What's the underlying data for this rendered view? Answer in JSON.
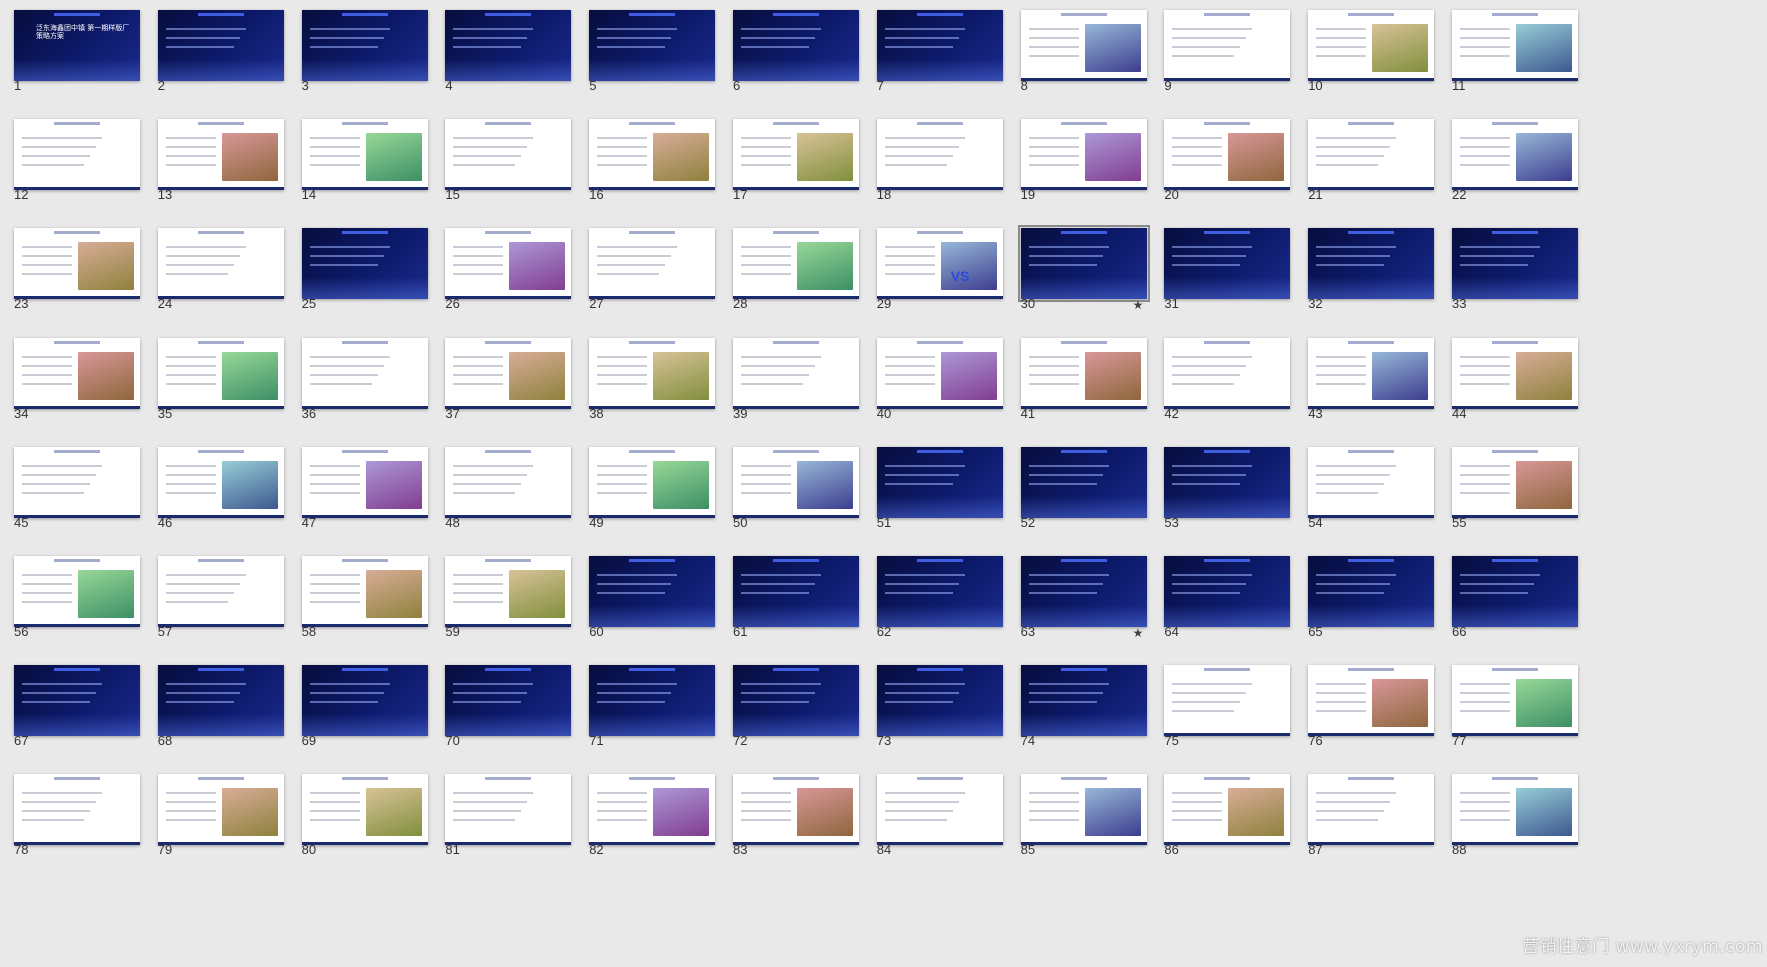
{
  "slides": [
    {
      "number": "1",
      "bg": "dark",
      "title": "泛东海鑫团中镇 第一期样版厂 策略方案"
    },
    {
      "number": "2",
      "bg": "dark"
    },
    {
      "number": "3",
      "bg": "dark"
    },
    {
      "number": "4",
      "bg": "dark"
    },
    {
      "number": "5",
      "bg": "dark"
    },
    {
      "number": "6",
      "bg": "dark"
    },
    {
      "number": "7",
      "bg": "dark"
    },
    {
      "number": "8",
      "bg": "light"
    },
    {
      "number": "9",
      "bg": "light"
    },
    {
      "number": "10",
      "bg": "light"
    },
    {
      "number": "11",
      "bg": "light"
    },
    {
      "number": "12",
      "bg": "light"
    },
    {
      "number": "13",
      "bg": "light"
    },
    {
      "number": "14",
      "bg": "light"
    },
    {
      "number": "15",
      "bg": "light"
    },
    {
      "number": "16",
      "bg": "light"
    },
    {
      "number": "17",
      "bg": "light"
    },
    {
      "number": "18",
      "bg": "light"
    },
    {
      "number": "19",
      "bg": "light"
    },
    {
      "number": "20",
      "bg": "light"
    },
    {
      "number": "21",
      "bg": "light"
    },
    {
      "number": "22",
      "bg": "light"
    },
    {
      "number": "23",
      "bg": "light"
    },
    {
      "number": "24",
      "bg": "light"
    },
    {
      "number": "25",
      "bg": "dark"
    },
    {
      "number": "26",
      "bg": "light"
    },
    {
      "number": "27",
      "bg": "light"
    },
    {
      "number": "28",
      "bg": "light"
    },
    {
      "number": "29",
      "bg": "light",
      "vs": "VS"
    },
    {
      "number": "30",
      "bg": "dark",
      "selected": true,
      "starred": true
    },
    {
      "number": "31",
      "bg": "dark"
    },
    {
      "number": "32",
      "bg": "dark"
    },
    {
      "number": "33",
      "bg": "dark"
    },
    {
      "number": "34",
      "bg": "light"
    },
    {
      "number": "35",
      "bg": "light"
    },
    {
      "number": "36",
      "bg": "light"
    },
    {
      "number": "37",
      "bg": "light"
    },
    {
      "number": "38",
      "bg": "light"
    },
    {
      "number": "39",
      "bg": "light"
    },
    {
      "number": "40",
      "bg": "light"
    },
    {
      "number": "41",
      "bg": "light"
    },
    {
      "number": "42",
      "bg": "light"
    },
    {
      "number": "43",
      "bg": "light"
    },
    {
      "number": "44",
      "bg": "light"
    },
    {
      "number": "45",
      "bg": "light"
    },
    {
      "number": "46",
      "bg": "light"
    },
    {
      "number": "47",
      "bg": "light"
    },
    {
      "number": "48",
      "bg": "light"
    },
    {
      "number": "49",
      "bg": "light"
    },
    {
      "number": "50",
      "bg": "light"
    },
    {
      "number": "51",
      "bg": "dark"
    },
    {
      "number": "52",
      "bg": "dark"
    },
    {
      "number": "53",
      "bg": "dark"
    },
    {
      "number": "54",
      "bg": "light"
    },
    {
      "number": "55",
      "bg": "light"
    },
    {
      "number": "56",
      "bg": "light"
    },
    {
      "number": "57",
      "bg": "light"
    },
    {
      "number": "58",
      "bg": "light"
    },
    {
      "number": "59",
      "bg": "light"
    },
    {
      "number": "60",
      "bg": "dark"
    },
    {
      "number": "61",
      "bg": "dark"
    },
    {
      "number": "62",
      "bg": "dark"
    },
    {
      "number": "63",
      "bg": "dark",
      "starred": true
    },
    {
      "number": "64",
      "bg": "dark"
    },
    {
      "number": "65",
      "bg": "dark"
    },
    {
      "number": "66",
      "bg": "dark"
    },
    {
      "number": "67",
      "bg": "dark"
    },
    {
      "number": "68",
      "bg": "dark"
    },
    {
      "number": "69",
      "bg": "dark"
    },
    {
      "number": "70",
      "bg": "dark"
    },
    {
      "number": "71",
      "bg": "dark"
    },
    {
      "number": "72",
      "bg": "dark"
    },
    {
      "number": "73",
      "bg": "dark"
    },
    {
      "number": "74",
      "bg": "dark"
    },
    {
      "number": "75",
      "bg": "light"
    },
    {
      "number": "76",
      "bg": "light"
    },
    {
      "number": "77",
      "bg": "light"
    },
    {
      "number": "78",
      "bg": "light"
    },
    {
      "number": "79",
      "bg": "light"
    },
    {
      "number": "80",
      "bg": "light"
    },
    {
      "number": "81",
      "bg": "light"
    },
    {
      "number": "82",
      "bg": "light"
    },
    {
      "number": "83",
      "bg": "light"
    },
    {
      "number": "84",
      "bg": "light"
    },
    {
      "number": "85",
      "bg": "light"
    },
    {
      "number": "86",
      "bg": "light"
    },
    {
      "number": "87",
      "bg": "light"
    },
    {
      "number": "88",
      "bg": "light"
    }
  ],
  "star_glyph": "★",
  "watermark": "营销性意门 www.yxrym.com",
  "colors": {
    "dark_bg": "#0a1454",
    "accent": "#4466ee",
    "page_bg": "#e9e9e9"
  }
}
